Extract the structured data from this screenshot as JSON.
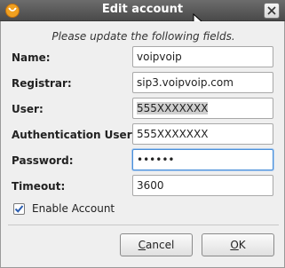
{
  "window": {
    "title": "Edit account"
  },
  "instructions": "Please update the following fields.",
  "fields": [
    {
      "label": "Name:",
      "value": "voipvoip"
    },
    {
      "label": "Registrar:",
      "value": "sip3.voipvoip.com"
    },
    {
      "label": "User:",
      "value": "555XXXXXXX"
    },
    {
      "label": "Authentication User:",
      "value": "555XXXXXXX"
    },
    {
      "label": "Password:",
      "value": "••••••"
    },
    {
      "label": "Timeout:",
      "value": "3600"
    }
  ],
  "enable_account": {
    "label": "Enable Account",
    "checked": true
  },
  "buttons": {
    "cancel_first": "C",
    "cancel_rest": "ancel",
    "ok_first": "O",
    "ok_rest": "K"
  },
  "colors": {
    "titlebar": "#4a4a4a",
    "accent_focus": "#4a90d9",
    "checkbox_check": "#2a5db0"
  }
}
